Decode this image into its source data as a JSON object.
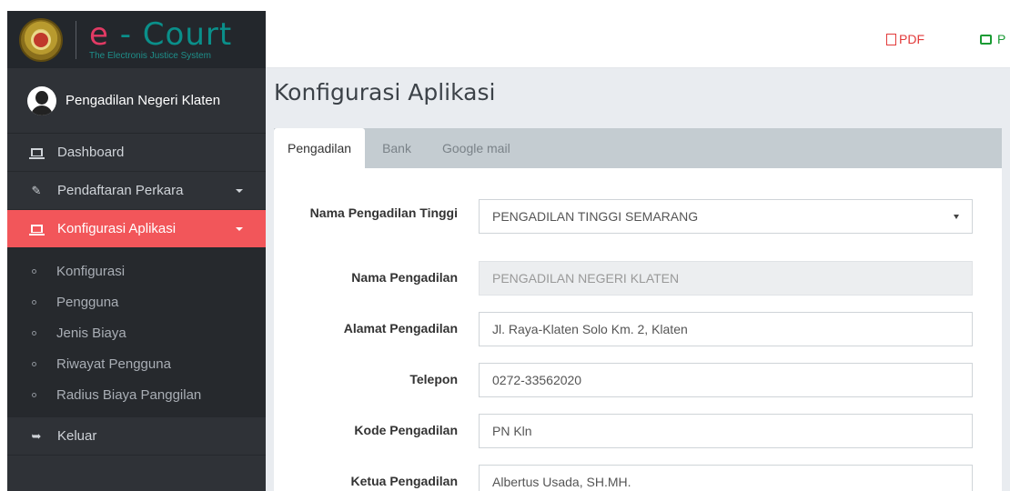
{
  "brand": {
    "title_e": "e",
    "title_rest": " - Court",
    "subtitle": "The Electronis Justice System"
  },
  "user": {
    "name": "Pengadilan Negeri Klaten"
  },
  "sidebar": {
    "items": [
      {
        "label": "Dashboard",
        "icon": "laptop-icon"
      },
      {
        "label": "Pendaftaran Perkara",
        "icon": "edit-icon"
      },
      {
        "label": "Konfigurasi Aplikasi",
        "icon": "laptop-icon",
        "active": true
      }
    ],
    "submenu": [
      "Konfigurasi",
      "Pengguna",
      "Jenis Biaya",
      "Riwayat Pengguna",
      "Radius Biaya Panggilan"
    ],
    "logout": {
      "label": "Keluar",
      "icon": "sign-out-icon"
    }
  },
  "topbar": {
    "pdf_label": "PDF",
    "print_label": "P"
  },
  "page": {
    "title": "Konfigurasi Aplikasi"
  },
  "tabs": [
    "Pengadilan",
    "Bank",
    "Google mail"
  ],
  "form": {
    "fields": [
      {
        "label": "Nama Pengadilan Tinggi",
        "value": "PENGADILAN TINGGI SEMARANG"
      },
      {
        "label": "Nama Pengadilan",
        "value": "PENGADILAN NEGERI KLATEN"
      },
      {
        "label": "Alamat Pengadilan",
        "value": "Jl. Raya-Klaten Solo Km. 2, Klaten"
      },
      {
        "label": "Telepon",
        "value": "0272-33562020"
      },
      {
        "label": "Kode Pengadilan",
        "value": "PN Kln"
      },
      {
        "label": "Ketua Pengadilan",
        "value": "Albertus Usada, SH.MH."
      }
    ]
  },
  "colors": {
    "accent": "#f2565a",
    "sidebar": "#2f3237",
    "brand_teal": "#0a8f8a",
    "pdf": "#e23a3a",
    "print": "#1a9b34"
  }
}
